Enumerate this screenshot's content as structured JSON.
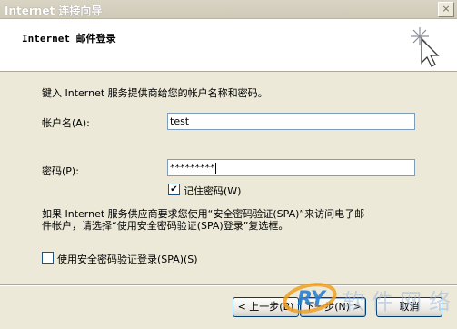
{
  "window": {
    "title": "Internet 连接向导",
    "close_glyph": "×"
  },
  "header": {
    "heading": "Internet 邮件登录",
    "icon": "wizard-sparkle-cursor-icon"
  },
  "main": {
    "intro": "键入 Internet 服务提供商给您的帐户名称和密码。",
    "account": {
      "label": "帐户名(A):",
      "value": "test"
    },
    "password": {
      "label": "密码(P):",
      "value": "*********"
    },
    "remember": {
      "label": "记住密码(W)",
      "checked": true
    },
    "spa_note_line1": "如果 Internet 服务供应商要求您使用“安全密码验证(SPA)”来访问电子邮",
    "spa_note_line2": "件帐户，请选择“使用安全密码验证(SPA)登录”复选框。",
    "spa": {
      "label": "使用安全密码验证登录(SPA)(S)",
      "checked": false
    }
  },
  "buttons": {
    "back": "< 上一步(B)",
    "next": "下一步(N) >",
    "cancel": "取消"
  },
  "watermark": {
    "logo_text": "RY",
    "text": "软 件 网 络"
  },
  "colors": {
    "dialog_bg": "#ece9d8",
    "header_bg": "#ffffff",
    "textbox_border": "#7f9db9",
    "button_border": "#003c74"
  }
}
